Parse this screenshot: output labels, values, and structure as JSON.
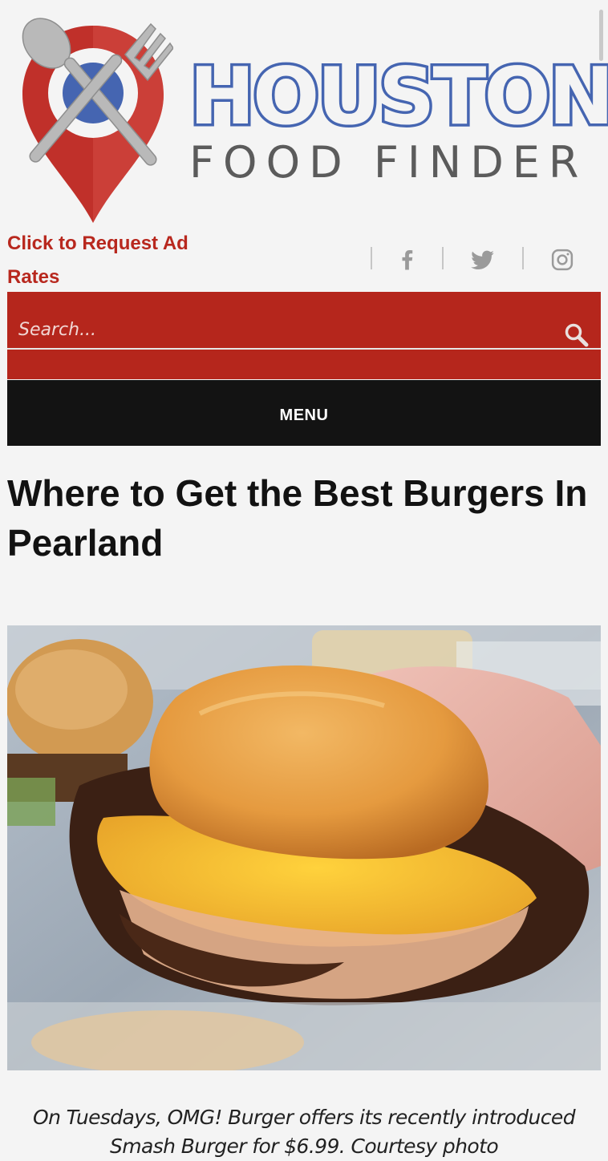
{
  "logo": {
    "title": "HOUSTON",
    "subtitle": "FOOD FINDER",
    "colors": {
      "blue": "#4565b1",
      "red": "#c0302a",
      "grey": "#5b5b5b"
    }
  },
  "header": {
    "ad_link": "Click to Request Ad Rates",
    "social": [
      {
        "icon": "facebook-icon"
      },
      {
        "icon": "twitter-icon"
      },
      {
        "icon": "instagram-icon"
      }
    ]
  },
  "search": {
    "placeholder": "Search..."
  },
  "nav": {
    "menu_label": "MENU"
  },
  "article": {
    "title": "Where to Get the Best Burgers In Pearland",
    "image": {
      "subject": "burger-photo"
    },
    "caption": "On Tuesdays, OMG! Burger offers its recently introduced Smash Burger for $6.99. Courtesy photo"
  },
  "theme": {
    "accent": "#b5261c",
    "menu_bg": "#131313",
    "page_bg": "#f4f4f4"
  }
}
